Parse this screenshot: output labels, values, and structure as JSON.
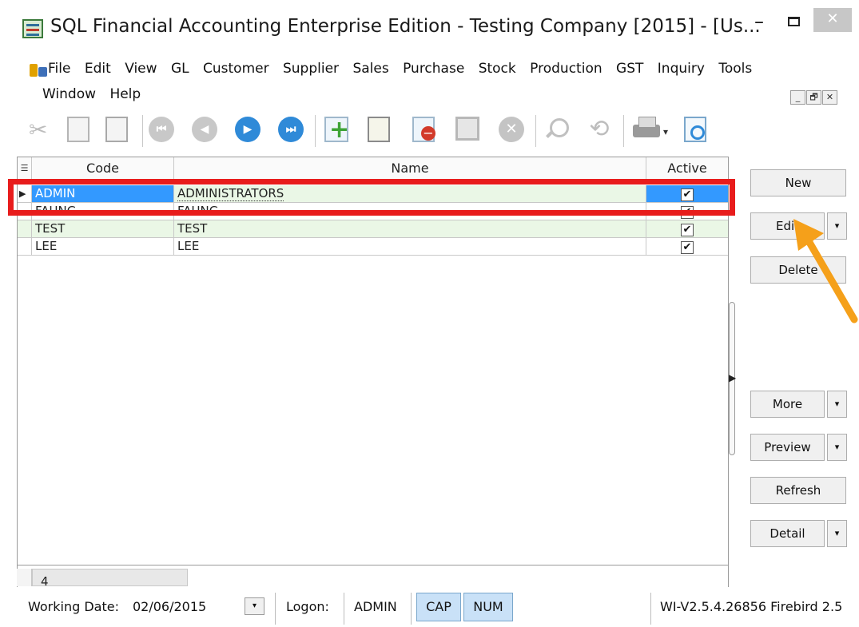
{
  "window": {
    "title": "SQL Financial Accounting Enterprise Edition - Testing Company [2015] - [Us...",
    "close_glyph": "✕",
    "minimize_glyph": "–"
  },
  "menu": {
    "items_row1": [
      "File",
      "Edit",
      "View",
      "GL",
      "Customer",
      "Supplier",
      "Sales",
      "Purchase",
      "Stock",
      "Production",
      "GST",
      "Inquiry",
      "Tools"
    ],
    "items_row2": [
      "Window",
      "Help"
    ],
    "mdi_buttons": [
      "_",
      "🗗",
      "✕"
    ]
  },
  "toolbar": {
    "icons": [
      "cut-icon",
      "copy-icon",
      "paste-icon",
      "first-record-icon",
      "previous-record-icon",
      "next-record-icon",
      "last-record-icon",
      "new-record-icon",
      "edit-record-icon",
      "delete-record-icon",
      "save-icon",
      "cancel-icon",
      "find-icon",
      "refresh-icon",
      "print-icon",
      "print-preview-icon"
    ],
    "print_dropdown": "▾"
  },
  "grid": {
    "columns": [
      "Code",
      "Name",
      "Active"
    ],
    "rows": [
      {
        "code": "ADMIN",
        "name": "ADMINISTRATORS",
        "active": "✔"
      },
      {
        "code": "FAUNG",
        "name": "FAUNG",
        "active": "✔"
      },
      {
        "code": "TEST",
        "name": "TEST",
        "active": "✔"
      },
      {
        "code": "LEE",
        "name": "LEE",
        "active": "✔"
      }
    ],
    "selected_row": 0,
    "row_indicator": "▶",
    "record_count": "4"
  },
  "side_buttons": {
    "new": "New",
    "edit": "Edit",
    "delete": "Delete",
    "more": "More",
    "preview": "Preview",
    "refresh": "Refresh",
    "detail": "Detail",
    "dropdown_glyph": "▾"
  },
  "statusbar": {
    "working_date_label": "Working Date:",
    "working_date_value": "02/06/2015",
    "logon_label": "Logon:",
    "logon_user": "ADMIN",
    "cap": "CAP",
    "num": "NUM",
    "version": "WI-V2.5.4.26856 Firebird 2.5"
  },
  "colors": {
    "selection": "#3399ff",
    "alt_row": "#eaf7e6",
    "highlight_box": "#e81c1c",
    "pointer_arrow": "#f5a01a"
  }
}
